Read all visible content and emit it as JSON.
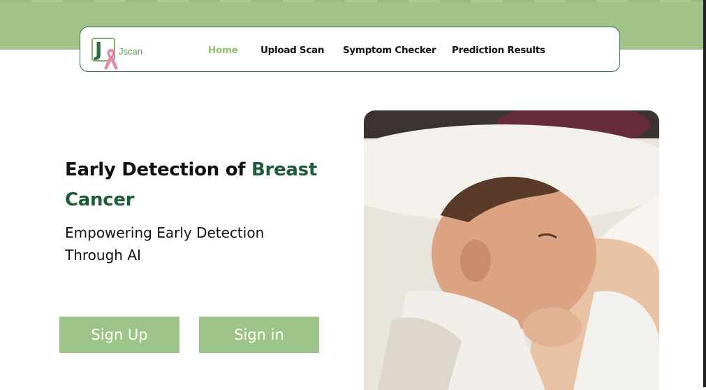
{
  "brand": {
    "name": "Jscan",
    "logo_letter": "J"
  },
  "nav": {
    "items": [
      {
        "label": "Home",
        "active": true
      },
      {
        "label": "Upload Scan",
        "active": false
      },
      {
        "label": "Symptom Checker",
        "active": false
      },
      {
        "label": "Prediction Results",
        "active": false
      }
    ]
  },
  "hero": {
    "title_part1": "Early Detection of ",
    "title_part2": "Breast Cancer",
    "subtitle": "Empowering Early Detection Through AI",
    "image_alt": "Mother breastfeeding a newborn baby"
  },
  "buttons": {
    "sign_up": "Sign Up",
    "sign_in": "Sign in"
  },
  "colors": {
    "header_band": "#a0c488",
    "accent_dark_green": "#1f5a3a",
    "active_nav": "#8fbf73",
    "button_bg": "#9cc488",
    "ribbon": "#e48aa8"
  },
  "icons": {
    "logo": "pink-ribbon-icon"
  }
}
